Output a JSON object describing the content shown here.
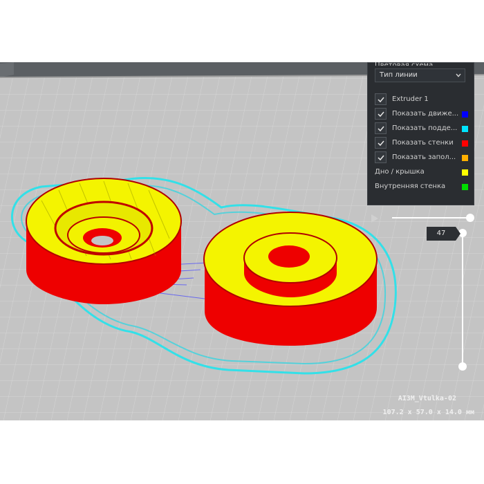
{
  "color_scheme": {
    "header_partial": "Цветовая схема",
    "selected": "Тип линии"
  },
  "legend": {
    "items": [
      {
        "label": "Extruder 1",
        "checked": true,
        "color": ""
      },
      {
        "label": "Показать движе...",
        "checked": true,
        "color": "#0000ff"
      },
      {
        "label": "Показать подде...",
        "checked": true,
        "color": "#00e5ff"
      },
      {
        "label": "Показать стенки",
        "checked": true,
        "color": "#ff0000"
      },
      {
        "label": "Показать запол...",
        "checked": true,
        "color": "#ffb000"
      },
      {
        "label": "Дно / крышка",
        "checked": false,
        "color": "#ffff00"
      },
      {
        "label": "Внутренняя стенка",
        "checked": false,
        "color": "#00dd00"
      }
    ]
  },
  "layer_slider": {
    "current_layer": "47",
    "level": 1.0
  },
  "model": {
    "name": "AI3M_Vtulka-02",
    "dimensions": "107.2 x 57.0 x 14.0 мм"
  },
  "colors": {
    "panel_bg": "#2a2d31",
    "build_plate": "#c4c4c4",
    "wall": "#ff0000",
    "top_bottom": "#ffff00",
    "support": "#00e5ff",
    "travel": "#0000ff"
  }
}
